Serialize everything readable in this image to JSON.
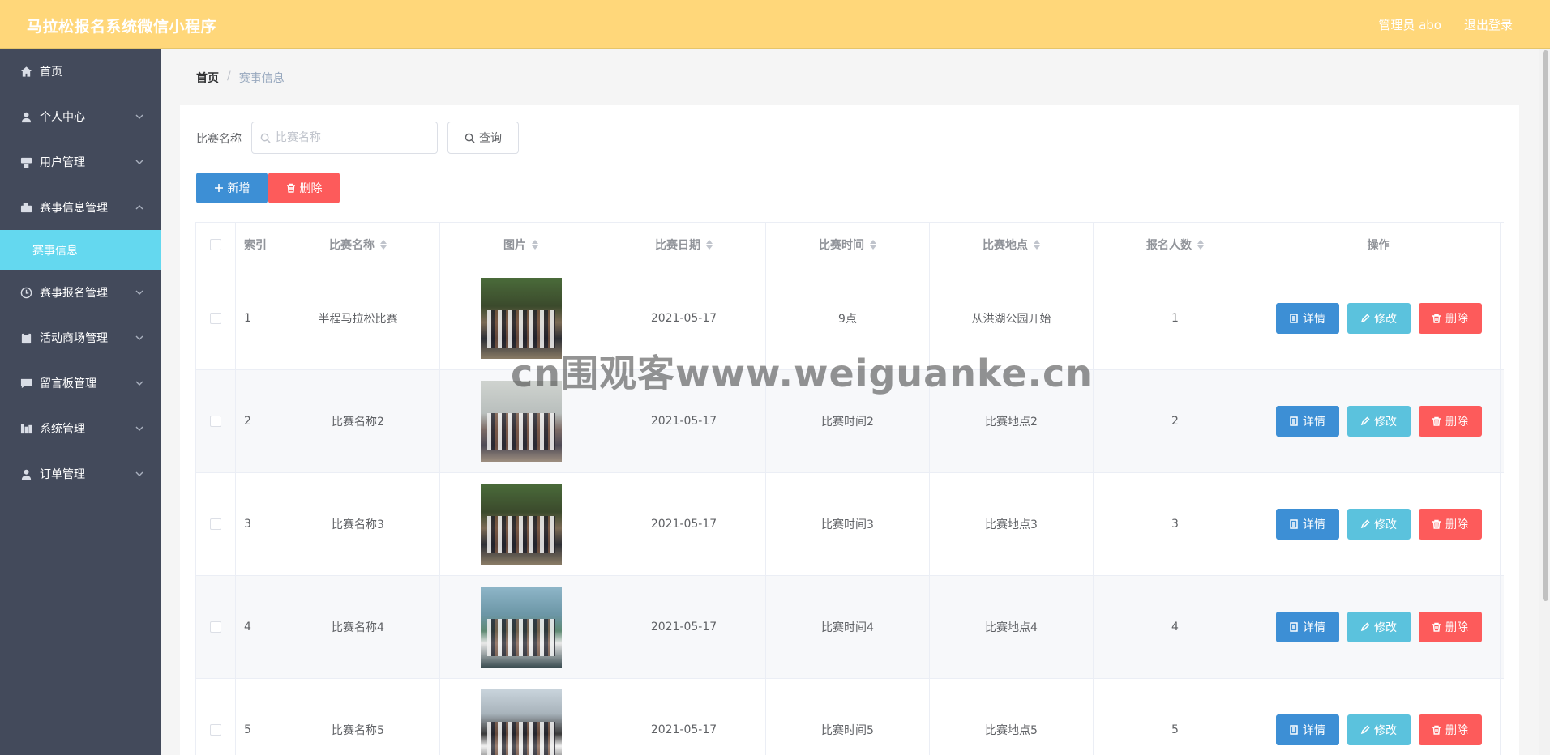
{
  "header": {
    "title": "马拉松报名系统微信小程序",
    "user": "管理员 abo",
    "logout": "退出登录"
  },
  "sidebar": {
    "items": [
      {
        "label": "首页",
        "icon": "home-icon"
      },
      {
        "label": "个人中心",
        "icon": "user-icon"
      },
      {
        "label": "用户管理",
        "icon": "users-icon"
      },
      {
        "label": "赛事信息管理",
        "icon": "info-icon"
      },
      {
        "label": "赛事报名管理",
        "icon": "clock-icon"
      },
      {
        "label": "活动商场管理",
        "icon": "clipboard-icon"
      },
      {
        "label": "留言板管理",
        "icon": "message-icon"
      },
      {
        "label": "系统管理",
        "icon": "system-icon"
      },
      {
        "label": "订单管理",
        "icon": "order-icon"
      }
    ],
    "active_sub": "赛事信息"
  },
  "breadcrumb": {
    "home": "首页",
    "sep": "/",
    "current": "赛事信息"
  },
  "search": {
    "label": "比赛名称",
    "placeholder": "比赛名称",
    "query_label": "查询"
  },
  "actions": {
    "add_label": "新增",
    "delete_label": "删除"
  },
  "table": {
    "columns": [
      "索引",
      "比赛名称",
      "图片",
      "比赛日期",
      "比赛时间",
      "比赛地点",
      "报名人数",
      "操作"
    ],
    "rows": [
      {
        "index": "1",
        "name": "半程马拉松比赛",
        "date": "2021-05-17",
        "time": "9点",
        "place": "从洪湖公园开始",
        "count": "1"
      },
      {
        "index": "2",
        "name": "比赛名称2",
        "date": "2021-05-17",
        "time": "比赛时间2",
        "place": "比赛地点2",
        "count": "2"
      },
      {
        "index": "3",
        "name": "比赛名称3",
        "date": "2021-05-17",
        "time": "比赛时间3",
        "place": "比赛地点3",
        "count": "3"
      },
      {
        "index": "4",
        "name": "比赛名称4",
        "date": "2021-05-17",
        "time": "比赛时间4",
        "place": "比赛地点4",
        "count": "4"
      },
      {
        "index": "5",
        "name": "比赛名称5",
        "date": "2021-05-17",
        "time": "比赛时间5",
        "place": "比赛地点5",
        "count": "5"
      }
    ],
    "ops": {
      "detail": "详情",
      "edit": "修改",
      "delete": "删除"
    }
  },
  "watermark": "cn围观客www.weiguanke.cn",
  "colors": {
    "topbar": "#ffd77a",
    "sidebar": "#434a5b",
    "active_sub": "#64d8ef",
    "primary": "#3d8fd5",
    "info": "#5bc2dd",
    "danger": "#fd5b5b"
  }
}
